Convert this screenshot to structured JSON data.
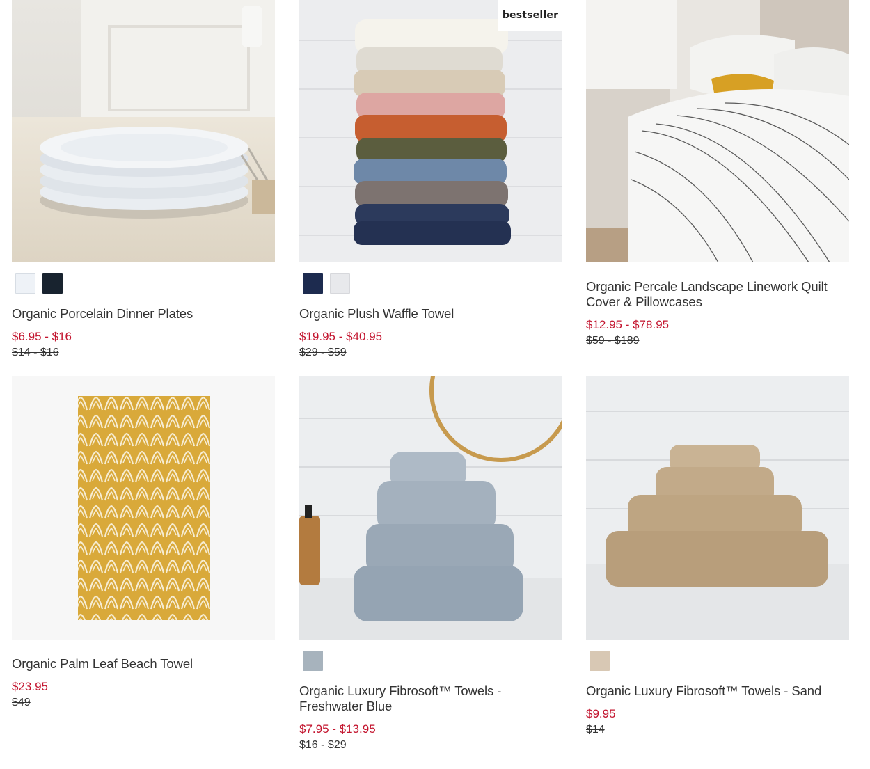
{
  "products": [
    {
      "title": "Organic Porcelain Dinner Plates",
      "price": "$6.95 - $16",
      "original_price": "$14 - $16",
      "swatches": [
        "#eef2f7",
        "#18232f"
      ]
    },
    {
      "badge": "bestseller",
      "title": "Organic Plush Waffle Towel",
      "price": "$19.95 - $40.95",
      "original_price": "$29 - $59",
      "swatches": [
        "#1d2b4f",
        "#e8e9ec"
      ]
    },
    {
      "title": "Organic Percale Landscape Linework Quilt Cover & Pillowcases",
      "price": "$12.95 - $78.95",
      "original_price": "$59 - $189"
    },
    {
      "title": "Organic Palm Leaf Beach Towel",
      "price": "$23.95",
      "original_price": "$49"
    },
    {
      "title": "Organic Luxury Fibrosoft™ Towels - Freshwater Blue",
      "price": "$7.95 - $13.95",
      "original_price": "$16 - $29",
      "swatches": [
        "#a7b3bd"
      ]
    },
    {
      "title": "Organic Luxury Fibrosoft™ Towels - Sand",
      "price": "$9.95",
      "original_price": "$14",
      "swatches": [
        "#d8c8b4"
      ]
    }
  ],
  "colors": {
    "sale_price": "#c3142e",
    "text": "#333333"
  }
}
